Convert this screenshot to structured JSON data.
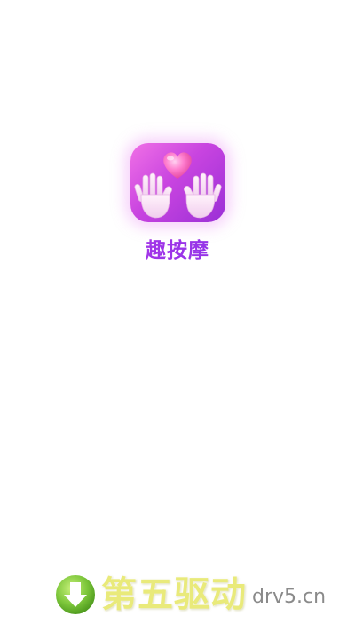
{
  "app": {
    "name": "趣按摩",
    "icon": "heart-hands-icon"
  },
  "colors": {
    "icon_gradient_start": "#f070e6",
    "icon_gradient_end": "#9a2fd6",
    "name_color": "#9b34e8",
    "watermark_text_color": "#e9ea7a",
    "watermark_badge_color": "#7cc63a"
  },
  "watermark": {
    "icon": "download-arrow-icon",
    "chinese_text": "第五驱动",
    "domain_text": "drv5.cn"
  }
}
